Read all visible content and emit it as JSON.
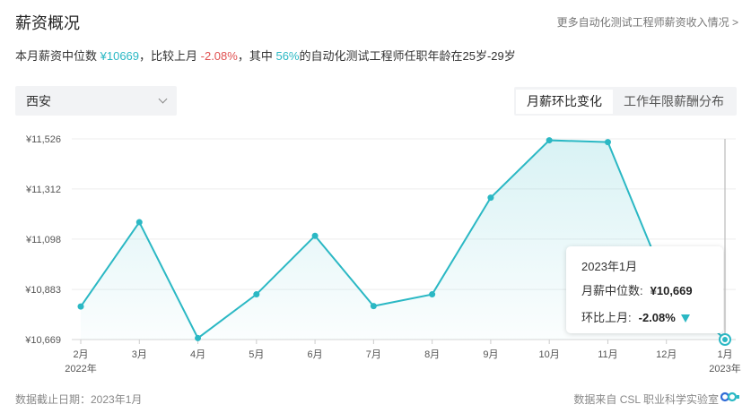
{
  "header": {
    "title": "薪资概况",
    "more_link": "更多自动化测试工程师薪资收入情况 >"
  },
  "summary": {
    "prefix": "本月薪资中位数 ",
    "median": "¥10669",
    "mid1": "，比较上月 ",
    "change": "-2.08%",
    "mid2": "，其中 ",
    "percent": "56%",
    "suffix": "的自动化测试工程师任职年龄在25岁-29岁"
  },
  "city_select": {
    "value": "西安",
    "icon": "chevron-down-icon"
  },
  "tabs": [
    {
      "label": "月薪环比变化",
      "active": true
    },
    {
      "label": "工作年限薪酬分布",
      "active": false
    }
  ],
  "colors": {
    "accent": "#2bb8c4",
    "negative": "#e05050"
  },
  "chart_data": {
    "type": "area",
    "categories": [
      "2月",
      "3月",
      "4月",
      "5月",
      "6月",
      "7月",
      "8月",
      "9月",
      "10月",
      "11月",
      "12月",
      "1月"
    ],
    "category_years": [
      "2022年",
      "",
      "",
      "",
      "",
      "",
      "",
      "",
      "",
      "",
      "",
      "2023年"
    ],
    "values": [
      10810,
      11170,
      10675,
      10862,
      11112,
      10812,
      10862,
      11275,
      11520,
      11512,
      10905,
      10669
    ],
    "y_ticks": [
      "¥11,526",
      "¥11,312",
      "¥11,098",
      "¥10,883",
      "¥10,669"
    ],
    "y_tick_values": [
      11526,
      11312,
      11098,
      10883,
      10669
    ],
    "ylim": [
      10669,
      11526
    ],
    "grid": true,
    "highlight_index": 11
  },
  "tooltip": {
    "date": "2023年1月",
    "median_label": "月薪中位数:",
    "median_value": "¥10,669",
    "change_label": "环比上月:",
    "change_value": "-2.08%"
  },
  "footer": {
    "left": "数据截止日期：2023年1月",
    "right": "数据来自 CSL 职业科学实验室"
  }
}
